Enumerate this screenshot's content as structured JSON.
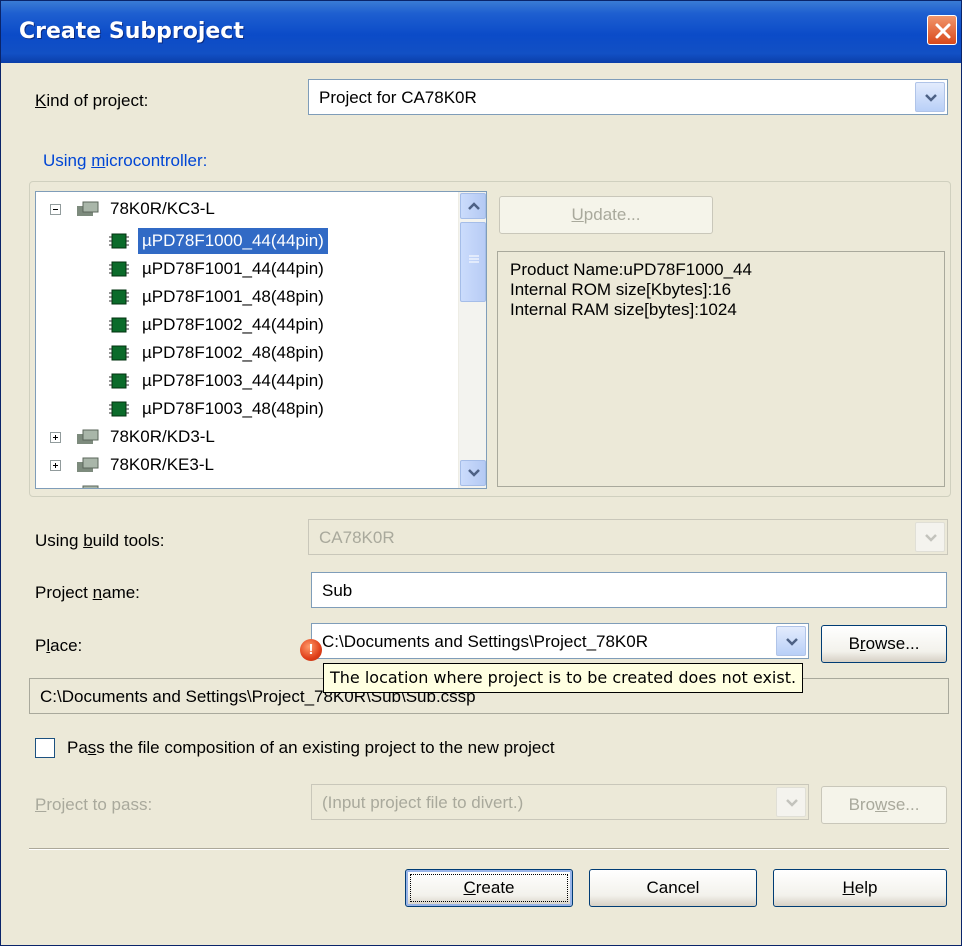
{
  "window": {
    "title": "Create Subproject"
  },
  "kind_of_project": {
    "label_pre": "",
    "label_key": "K",
    "label_post": "ind of project:",
    "value": "Project for CA78K0R"
  },
  "using_microcontroller": {
    "label_pre": "Using ",
    "label_key": "m",
    "label_post": "icrocontroller:"
  },
  "tree": {
    "groups_top": [
      {
        "label": "78K0R/KC3-L"
      }
    ],
    "chips": [
      {
        "label": "µPD78F1000_44(44pin)",
        "selected": true
      },
      {
        "label": "µPD78F1001_44(44pin)"
      },
      {
        "label": "µPD78F1001_48(48pin)"
      },
      {
        "label": "µPD78F1002_44(44pin)"
      },
      {
        "label": "µPD78F1002_48(48pin)"
      },
      {
        "label": "µPD78F1003_44(44pin)"
      },
      {
        "label": "µPD78F1003_48(48pin)"
      }
    ],
    "groups_bottom": [
      {
        "label": "78K0R/KD3-L"
      },
      {
        "label": "78K0R/KE3-L"
      }
    ]
  },
  "update_button": {
    "label_key": "U",
    "label_post": "pdate..."
  },
  "product_info": [
    "Product Name:uPD78F1000_44",
    "Internal ROM size[Kbytes]:16",
    "Internal RAM size[bytes]:1024"
  ],
  "build_tools": {
    "label_pre": "Using ",
    "label_key": "b",
    "label_post": "uild tools:",
    "value": "CA78K0R"
  },
  "project_name": {
    "label_pre": "Project ",
    "label_key": "n",
    "label_post": "ame:",
    "value": "Sub"
  },
  "place": {
    "label_pre": "P",
    "label_key": "l",
    "label_post": "ace:",
    "value": "C:\\Documents and Settings\\Project_78K0R",
    "browse_pre": "B",
    "browse_key": "r",
    "browse_post": "owse...",
    "tooltip": "The location where project is to be created does not exist.",
    "error_mark": "!"
  },
  "full_path": "C:\\Documents and Settings\\Project_78K0R\\Sub\\Sub.cssp",
  "pass_composition": {
    "label_pre": "Pa",
    "label_key": "s",
    "label_post": "s the file composition of an existing project to the new project",
    "checked": false
  },
  "project_to_pass": {
    "label_pre": "",
    "label_key": "P",
    "label_post": "roject to pass:",
    "placeholder": "(Input project file to divert.)",
    "browse_pre": "Bro",
    "browse_key": "w",
    "browse_post": "se..."
  },
  "buttons": {
    "create_key": "C",
    "create_post": "reate",
    "cancel": "Cancel",
    "help_key": "H",
    "help_post": "elp"
  },
  "colors": {
    "title_bar": "#0b4bc8",
    "selection": "#316ac5",
    "dialog_bg": "#ece9d8",
    "tooltip_bg": "#ffffe1"
  }
}
